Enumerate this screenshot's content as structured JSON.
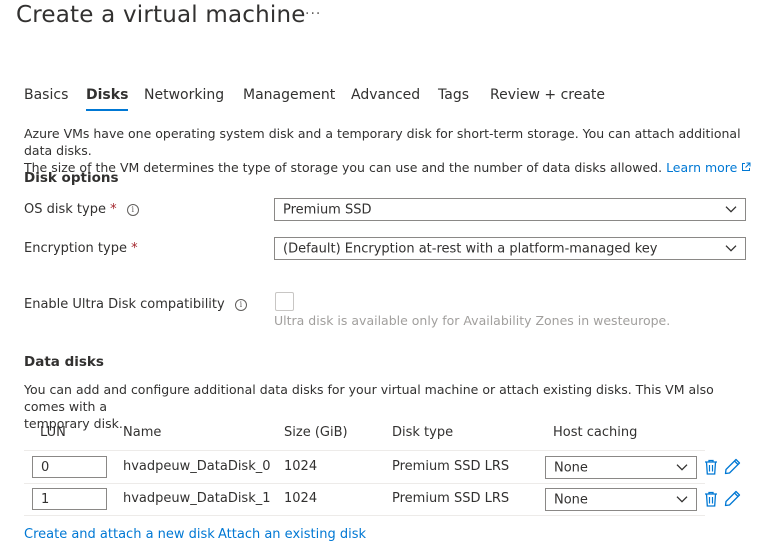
{
  "page": {
    "title": "Create a virtual machine",
    "more_label": "···"
  },
  "tabs": [
    {
      "label": "Basics",
      "active": false
    },
    {
      "label": "Disks",
      "active": true
    },
    {
      "label": "Networking",
      "active": false
    },
    {
      "label": "Management",
      "active": false
    },
    {
      "label": "Advanced",
      "active": false
    },
    {
      "label": "Tags",
      "active": false
    },
    {
      "label": "Review + create",
      "active": false
    }
  ],
  "intro": {
    "line1": "Azure VMs have one operating system disk and a temporary disk for short-term storage. You can attach additional data disks.",
    "line2": "The size of the VM determines the type of storage you can use and the number of data disks allowed.",
    "learn_more": "Learn more",
    "learn_more_icon": "external-link-icon"
  },
  "disk_options": {
    "heading": "Disk options",
    "os_disk_type": {
      "label": "OS disk type",
      "required": "*",
      "info_icon": "info-icon",
      "value": "Premium SSD"
    },
    "encryption_type": {
      "label": "Encryption type",
      "required": "*",
      "value": "(Default) Encryption at-rest with a platform-managed key"
    },
    "ultra_disk": {
      "label": "Enable Ultra Disk compatibility",
      "info_icon": "info-icon",
      "checked": false,
      "disabled": true,
      "hint": "Ultra disk is available only for Availability Zones in westeurope."
    }
  },
  "data_disks": {
    "heading": "Data disks",
    "description_line1": "You can add and configure additional data disks for your virtual machine or attach existing disks. This VM also comes with a",
    "description_line2": "temporary disk.",
    "columns": [
      "LUN",
      "Name",
      "Size (GiB)",
      "Disk type",
      "Host caching"
    ],
    "rows": [
      {
        "lun": "0",
        "name": "hvadpeuw_DataDisk_0",
        "size": "1024",
        "disk_type": "Premium SSD LRS",
        "host_caching": "None"
      },
      {
        "lun": "1",
        "name": "hvadpeuw_DataDisk_1",
        "size": "1024",
        "disk_type": "Premium SSD LRS",
        "host_caching": "None"
      }
    ],
    "create_link": "Create and attach a new disk",
    "attach_link": "Attach an existing disk"
  },
  "colors": {
    "accent": "#0078d4",
    "required": "#a4262c",
    "text": "#323130",
    "muted": "#a19f9d"
  }
}
